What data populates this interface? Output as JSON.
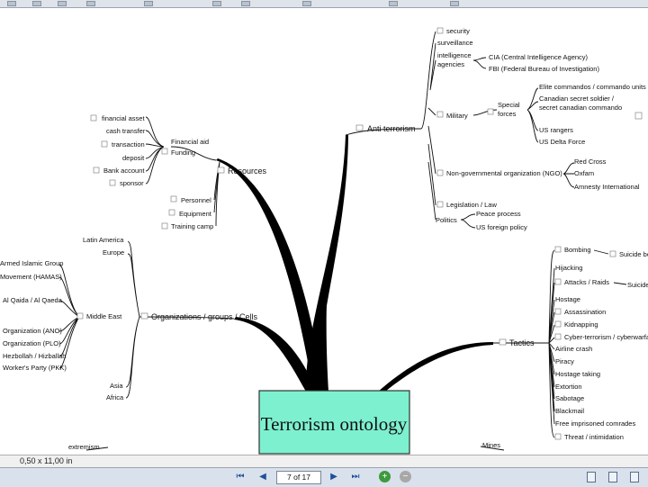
{
  "central": "Terrorism ontology",
  "anti_terrorism": {
    "label": "Anti terrorism",
    "security": "security",
    "surveillance": "surveillance",
    "intelligence": [
      "intelligence",
      "agencies"
    ],
    "cia": "CIA (Central Intelligence Agency)",
    "fbi": "FBI (Federal Bureau of Investigation)",
    "military": "Military",
    "special": [
      "Special",
      "forces"
    ],
    "elite": "Elite commandos / commando units",
    "canadian": [
      "Canadian secret soldier /",
      "secret canadian commando"
    ],
    "rangers": "US rangers",
    "delta": "US Delta Force",
    "ngo": "Non-governmental organization (NGO)",
    "red_cross": "Red Cross",
    "oxfam": "Oxfam",
    "amnesty": "Amnesty International",
    "legislation": "Legislation / Law",
    "politics": "Politics",
    "peace": "Peace process",
    "us_foreign": "US foreign policy"
  },
  "resources": {
    "label": "Resources",
    "financial_aid": [
      "Financial aid",
      "Funding"
    ],
    "fin_items": [
      "financial asset",
      "cash transfer",
      "transaction",
      "deposit",
      "Bank account",
      "sponsor"
    ],
    "personnel": "Personnel",
    "equipment": "Equipment",
    "training": "Training camp"
  },
  "organizations": {
    "label": "Organizations / groups / Cells",
    "latin_america": "Latin America",
    "europe": "Europe",
    "middle_east": "Middle East",
    "asia": "Asia",
    "africa": "Africa",
    "me_items": [
      "Armed Islamic Group",
      "Movement (HAMAS)",
      "Al Qaida / Al Qaeda",
      "Organization (ANO)",
      "Organization (PLO)",
      "Hezbollah / Hizballah",
      "Worker's Party (PKK)"
    ],
    "extremism": "extremism"
  },
  "tactics": {
    "label": "Tactics",
    "suicide": "Suicide bo",
    "suicide2": "Suicide",
    "items": [
      "Bombing",
      "Hijacking",
      "Attacks / Raids",
      "Hostage",
      "Assassination",
      "Kidnapping",
      "Cyber-terrorism / cyberwarfa",
      "Airline crash",
      "Piracy",
      "Hostage taking",
      "Extortion",
      "Sabotage",
      "Blackmail",
      "Free imprisoned comrades",
      "Threat / intimidation"
    ],
    "mines": "Mines"
  },
  "status": {
    "page_size": "0,50 x 11,00 in"
  },
  "nav": {
    "page_indicator": "7 of 17"
  },
  "colors": {
    "central_fill": "#7df0cf",
    "navbar": "#d9e1ec"
  }
}
